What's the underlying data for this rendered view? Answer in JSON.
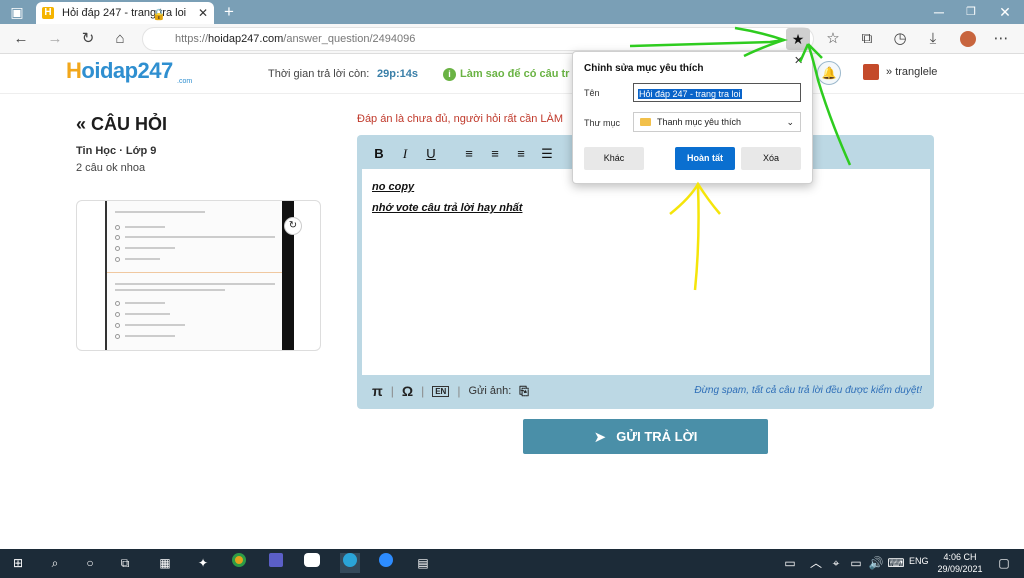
{
  "browser": {
    "tab_title": "Hỏi đáp 247 - trang tra loi",
    "url_prefix": "https://",
    "url_host": "hoidap247.com",
    "url_path": "/answer_question/2494096"
  },
  "site": {
    "logo_prefix": "H",
    "logo_rest": "oidap247",
    "logo_com": ".com",
    "timer_label": "Thời gian trả lời còn:",
    "timer_value": "29p:14s",
    "howto": "Làm sao để có câu tr",
    "username": "tranglele"
  },
  "question": {
    "back_title": "CÂU HỎI",
    "subject": "Tin Học · Lớp 9",
    "text": "2 câu ok nhoa"
  },
  "editor": {
    "notice": "Đáp án là chưa đủ, người hỏi rất cần LÀM",
    "lines": [
      "no copy ",
      "nhớ vote câu trả lời hay nhất"
    ],
    "upload_label": "Gửi ảnh:",
    "spam_notice": "Đừng spam, tất cả câu trả lời đều được kiểm duyệt!",
    "submit_label": "GỬI TRẢ LỜI"
  },
  "favorite_popup": {
    "title": "Chỉnh sửa mục yêu thích",
    "name_label": "Tên",
    "name_value": "Hỏi đáp 247 - trang tra loi",
    "folder_label": "Thư mục",
    "folder_value": "Thanh mục yêu thích",
    "btn_other": "Khác",
    "btn_done": "Hoàn tất",
    "btn_delete": "Xóa"
  },
  "taskbar": {
    "lang": "ENG",
    "time": "4:06 CH",
    "date": "29/09/2021"
  },
  "colors": {
    "annotation_green": "#2ecc1f",
    "annotation_yellow": "#f5e50a",
    "accent_blue": "#0a6fd0"
  }
}
